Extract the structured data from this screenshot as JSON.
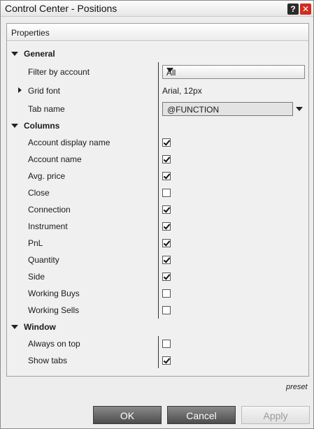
{
  "window": {
    "title": "Control Center - Positions",
    "help_icon": "?",
    "close_icon": "✕"
  },
  "panel": {
    "header": "Properties"
  },
  "general": {
    "label": "General",
    "filter_by_account_label": "Filter by account",
    "filter_by_account_value": "All",
    "grid_font_label": "Grid font",
    "grid_font_value": "Arial, 12px",
    "tab_name_label": "Tab name",
    "tab_name_value": "@FUNCTION"
  },
  "columns": {
    "label": "Columns",
    "items": [
      {
        "label": "Account display name",
        "checked": true
      },
      {
        "label": "Account name",
        "checked": true
      },
      {
        "label": "Avg. price",
        "checked": true
      },
      {
        "label": "Close",
        "checked": false
      },
      {
        "label": "Connection",
        "checked": true
      },
      {
        "label": "Instrument",
        "checked": true
      },
      {
        "label": "PnL",
        "checked": true
      },
      {
        "label": "Quantity",
        "checked": true
      },
      {
        "label": "Side",
        "checked": true
      },
      {
        "label": "Working Buys",
        "checked": false
      },
      {
        "label": "Working Sells",
        "checked": false
      }
    ]
  },
  "window_section": {
    "label": "Window",
    "items": [
      {
        "label": "Always on top",
        "checked": false
      },
      {
        "label": "Show tabs",
        "checked": true
      }
    ]
  },
  "footer": {
    "preset_label": "preset",
    "ok_label": "OK",
    "cancel_label": "Cancel",
    "apply_label": "Apply"
  }
}
